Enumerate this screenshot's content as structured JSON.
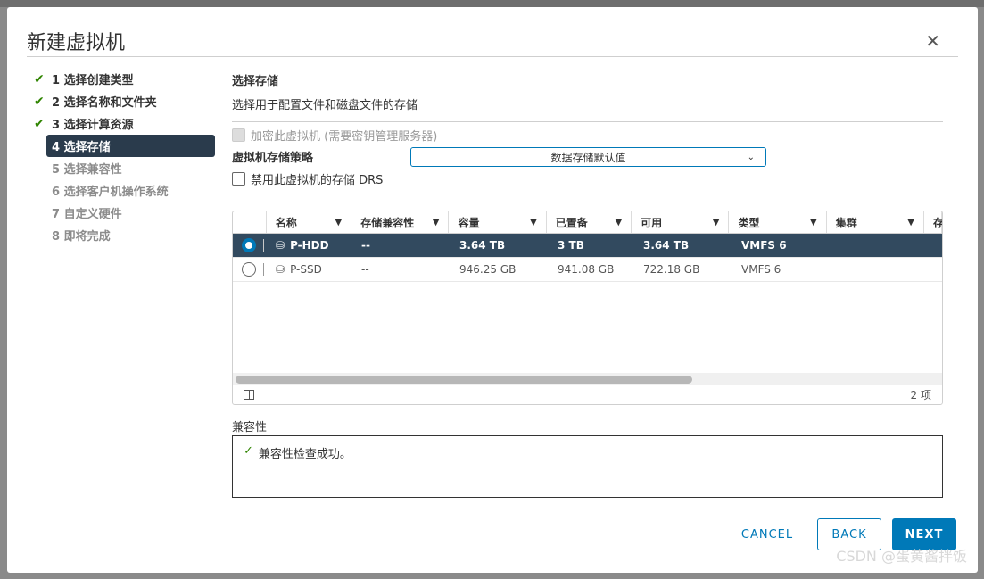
{
  "dialog": {
    "title": "新建虚拟机",
    "close_icon": "close-icon"
  },
  "steps": [
    {
      "label": "1 选择创建类型",
      "state": "done"
    },
    {
      "label": "2 选择名称和文件夹",
      "state": "done"
    },
    {
      "label": "3 选择计算资源",
      "state": "done"
    },
    {
      "label": "4 选择存储",
      "state": "active"
    },
    {
      "label": "5 选择兼容性",
      "state": "todo"
    },
    {
      "label": "6 选择客户机操作系统",
      "state": "todo"
    },
    {
      "label": "7 自定义硬件",
      "state": "todo"
    },
    {
      "label": "8 即将完成",
      "state": "todo"
    }
  ],
  "section": {
    "title": "选择存储",
    "subtitle": "选择用于配置文件和磁盘文件的存储"
  },
  "encrypt": {
    "label": "加密此虚拟机 (需要密钥管理服务器)"
  },
  "policy": {
    "label": "虚拟机存储策略",
    "value": "数据存储默认值"
  },
  "drs": {
    "label": "禁用此虚拟机的存储 DRS"
  },
  "grid": {
    "columns": [
      "名称",
      "存储兼容性",
      "容量",
      "已置备",
      "可用",
      "类型",
      "集群",
      "存"
    ],
    "rows": [
      {
        "name": "P-HDD",
        "compat": "--",
        "capacity": "3.64 TB",
        "provisioned": "3 TB",
        "free": "3.64 TB",
        "type": "VMFS 6",
        "cluster": "",
        "selected": true
      },
      {
        "name": "P-SSD",
        "compat": "--",
        "capacity": "946.25 GB",
        "provisioned": "941.08 GB",
        "free": "722.18 GB",
        "type": "VMFS 6",
        "cluster": "",
        "selected": false
      }
    ],
    "count": "2 项"
  },
  "compat": {
    "label": "兼容性",
    "message": "兼容性检查成功。"
  },
  "buttons": {
    "cancel": "CANCEL",
    "back": "BACK",
    "next": "NEXT"
  },
  "watermark": "CSDN @蛋黄酱拌饭",
  "colors": {
    "primary": "#0079b8",
    "active_step": "#2a3b4c",
    "selected_row": "#324a5f",
    "success": "#2f8400"
  }
}
